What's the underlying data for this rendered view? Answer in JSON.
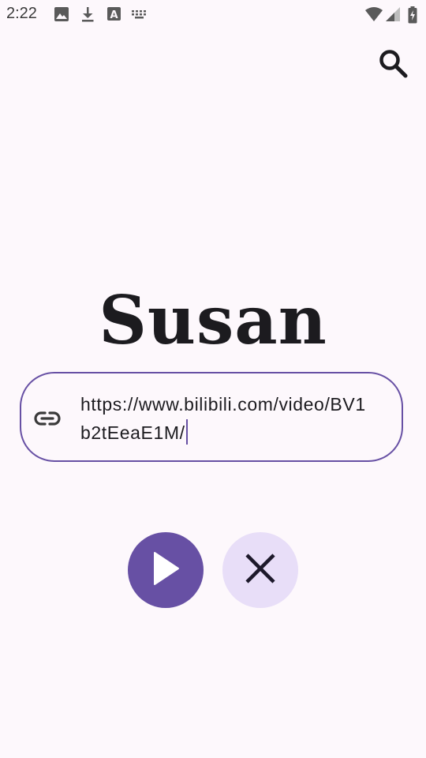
{
  "status_bar": {
    "time": "2:22",
    "icons": [
      "image-icon",
      "download-icon",
      "font-icon",
      "keyboard-icon",
      "wifi-icon",
      "signal-icon",
      "battery-icon"
    ]
  },
  "header": {
    "search_icon": "search-icon"
  },
  "main": {
    "title": "Susan",
    "url_field": {
      "icon": "link-icon",
      "value": "https://www.bilibili.com/video/BV1b2tEeaE1M/"
    },
    "actions": {
      "play_icon": "play-icon",
      "clear_icon": "close-icon"
    }
  },
  "colors": {
    "background": "#fdf8fc",
    "primary": "#6750a4",
    "secondary_container": "#e8def8",
    "on_surface": "#1c1b1f"
  }
}
